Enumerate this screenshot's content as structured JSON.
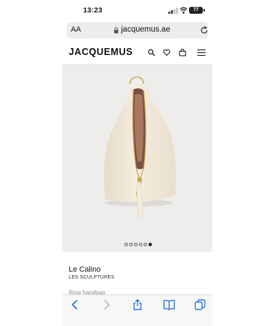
{
  "status_bar": {
    "time": "13:23",
    "battery": "77",
    "icons": [
      "signal-icon",
      "wifi-icon",
      "battery-icon"
    ]
  },
  "url_bar": {
    "text_size_label": "AA",
    "domain": "jacquemus.ae",
    "icons": [
      "lock-icon",
      "reload-icon"
    ]
  },
  "site_header": {
    "logo": "JACQUEMUS",
    "icons": [
      "search-icon",
      "heart-icon",
      "bag-icon",
      "menu-icon"
    ]
  },
  "product": {
    "image_alt": "Le Calino cream handbag",
    "carousel": {
      "count": 6,
      "active_index": 5
    },
    "name": "Le Calino",
    "collection": "LES SCULPTURES",
    "type": "Ring handbag"
  },
  "toolbar": {
    "icons": [
      "back-icon",
      "forward-icon",
      "share-icon",
      "bookmarks-icon",
      "tabs-icon"
    ]
  },
  "colors": {
    "image_background": "#eeedeb",
    "bag_cream": "#efe6d6",
    "zipper_gold": "#c9a24a",
    "ios_blue": "#1f6fe0"
  }
}
